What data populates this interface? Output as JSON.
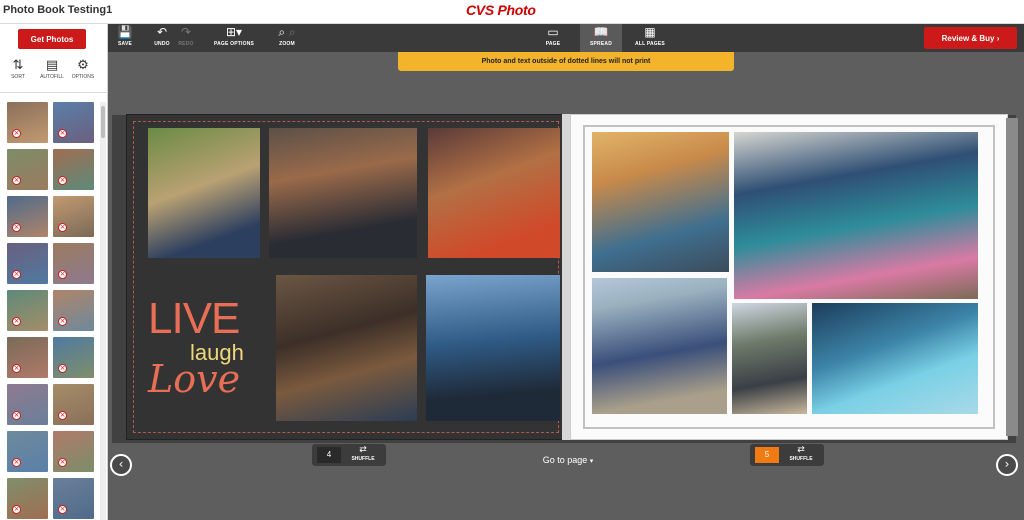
{
  "header": {
    "project_title": "Photo Book Testing1",
    "brand": "CVS Photo"
  },
  "sidebar": {
    "get_photos_label": "Get Photos",
    "tools": [
      {
        "label": "SORT",
        "icon": "sort-icon"
      },
      {
        "label": "AUTOFILL",
        "icon": "autofill-icon"
      },
      {
        "label": "OPTIONS",
        "icon": "gear-icon"
      }
    ],
    "thumbnail_count": 18
  },
  "toolbar": {
    "save_label": "SAVE",
    "undo_label": "UNDO",
    "redo_label": "REDO",
    "page_options_label": "PAGE OPTIONS",
    "zoom_label": "ZOOM",
    "page_label": "PAGE",
    "spread_label": "SPREAD",
    "all_pages_label": "ALL PAGES",
    "review_buy_label": "Review & Buy"
  },
  "notice": "Photo and text outside of dotted lines will not print",
  "left_page": {
    "text_art": {
      "line1": "LIVE",
      "line2": "laugh",
      "line3": "Love"
    },
    "number": "4",
    "shuffle_label": "SHUFFLE"
  },
  "right_page": {
    "number": "5",
    "shuffle_label": "SHUFFLE"
  },
  "go_to_page_label": "Go to page",
  "colors": {
    "brand_red": "#cc1a1a",
    "notice_yellow": "#f3b32a",
    "current_page_orange": "#f07b12",
    "toolbar_dark": "#3a3a3a"
  }
}
